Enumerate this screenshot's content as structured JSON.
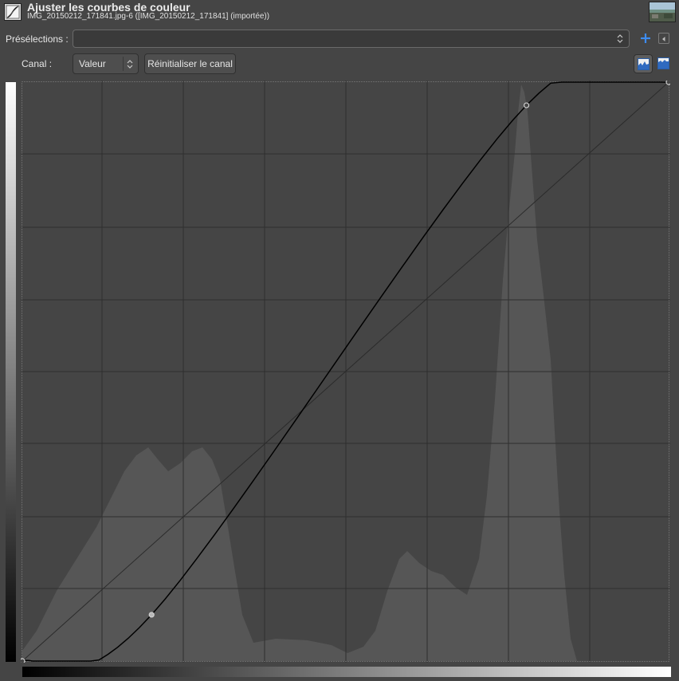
{
  "dialog": {
    "title": "Ajuster les courbes de couleur",
    "subtitle": "IMG_20150212_171841.jpg-6 ([IMG_20150212_171841] (importée))"
  },
  "presets": {
    "label": "Présélections :",
    "value": ""
  },
  "channel": {
    "label": "Canal :",
    "value": "Valeur",
    "reset_label": "Réinitialiser le canal"
  },
  "histogram_scale": "linear",
  "icons": {
    "app": "curves-tool-icon",
    "thumbnail": "image-thumbnail",
    "add": "plus-icon",
    "menu": "dialog-menu-icon",
    "hist_linear": "linear-histogram-icon",
    "hist_log": "log-histogram-icon"
  },
  "colors": {
    "accent": "#3d8cf0",
    "curve": "#000000",
    "grid": "#2f2f2f",
    "histogram": "#565656"
  },
  "curve_points": [
    [
      0,
      0
    ],
    [
      0.2,
      0.08
    ],
    [
      0.78,
      0.96
    ],
    [
      1.0,
      1.0
    ]
  ]
}
